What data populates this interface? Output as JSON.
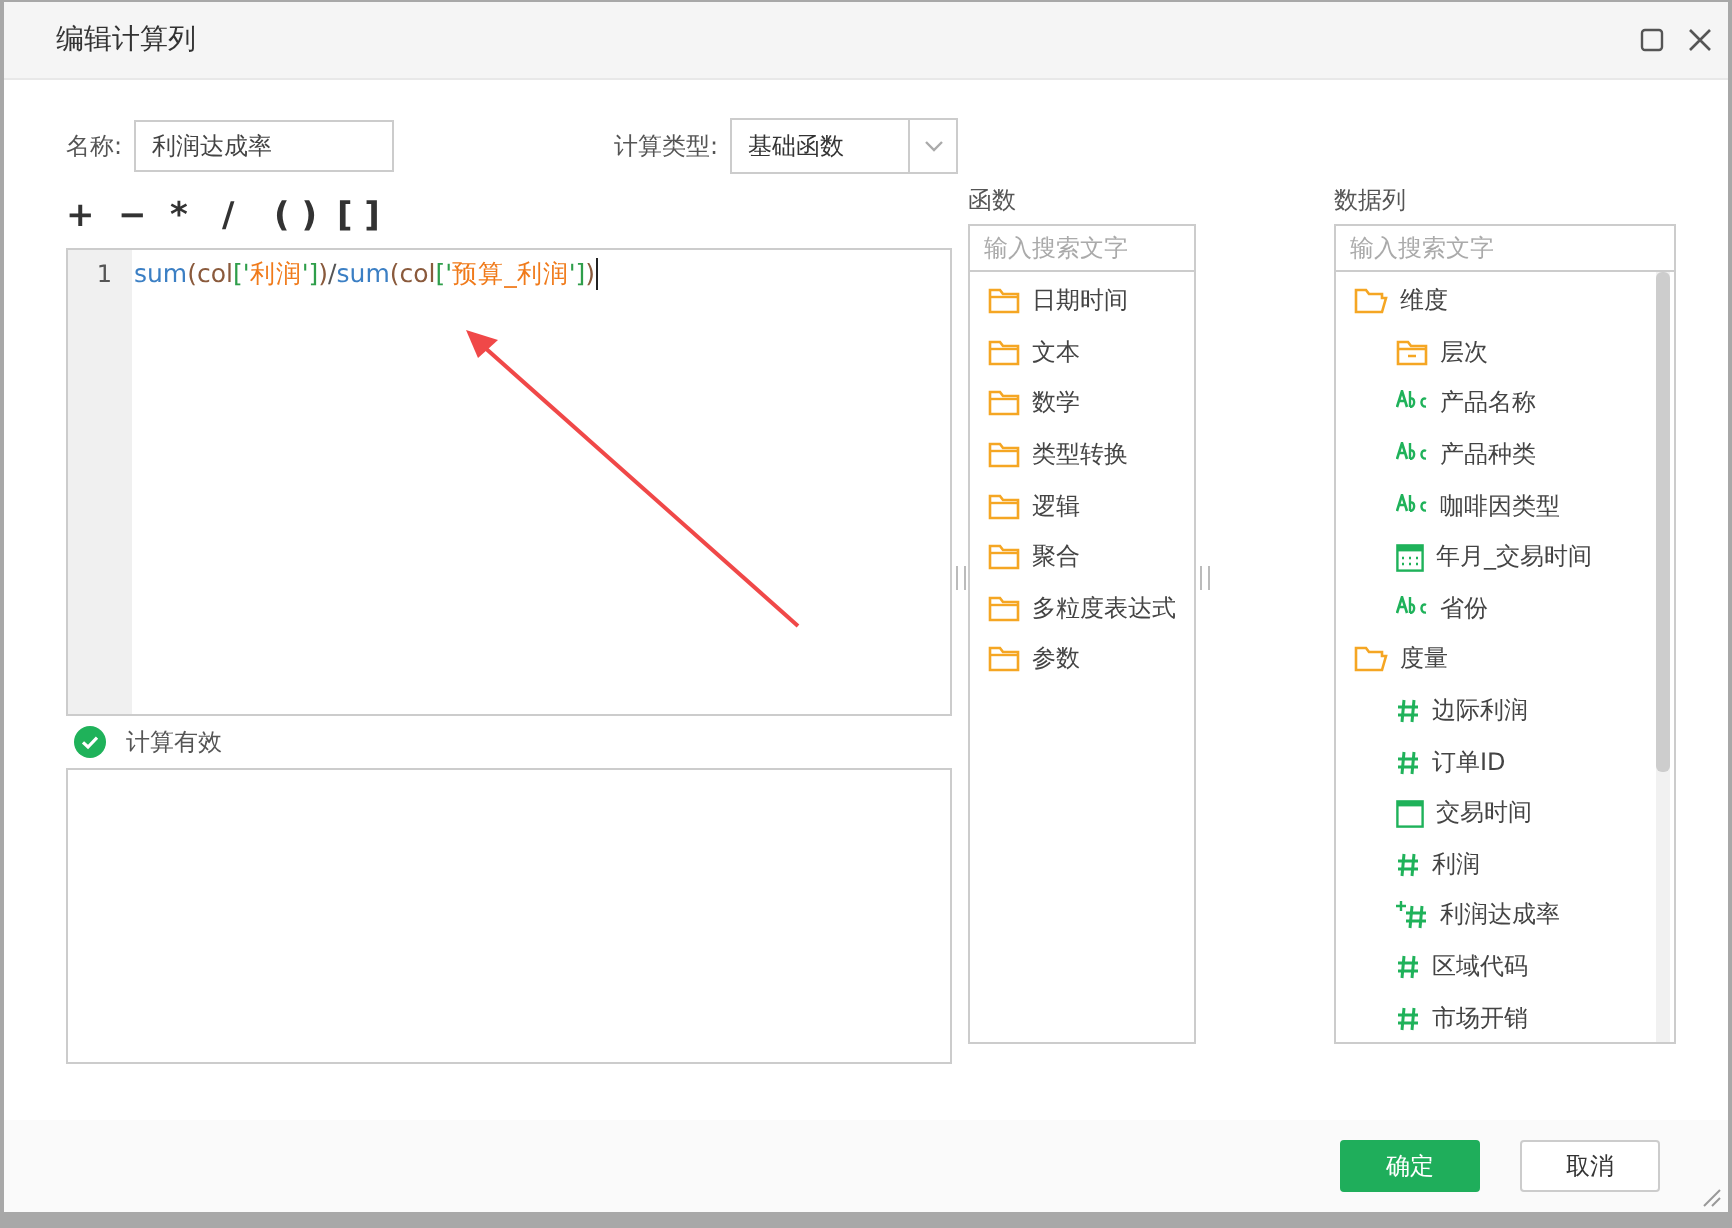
{
  "window": {
    "title": "编辑计算列"
  },
  "name_field": {
    "label": "名称:",
    "value": "利润达成率"
  },
  "calc_type": {
    "label": "计算类型:",
    "value": "基础函数"
  },
  "operators": [
    "+",
    "−",
    "*",
    "/",
    "( )",
    "[ ]"
  ],
  "editor": {
    "lines": [
      {
        "number": "1",
        "tokens": [
          {
            "kind": "func",
            "text": "sum"
          },
          {
            "kind": "paren",
            "text": "(col"
          },
          {
            "kind": "bracket",
            "text": "['"
          },
          {
            "kind": "string",
            "text": "利润"
          },
          {
            "kind": "bracket",
            "text": "']"
          },
          {
            "kind": "paren",
            "text": ")"
          },
          {
            "kind": "op",
            "text": "/"
          },
          {
            "kind": "func",
            "text": "sum"
          },
          {
            "kind": "paren",
            "text": "(col"
          },
          {
            "kind": "bracket",
            "text": "['"
          },
          {
            "kind": "string",
            "text": "预算_利润"
          },
          {
            "kind": "bracket",
            "text": "']"
          },
          {
            "kind": "paren",
            "text": ")"
          }
        ]
      }
    ]
  },
  "validation": {
    "valid": true,
    "message": "计算有效"
  },
  "functions": {
    "title": "函数",
    "search": {
      "placeholder": "输入搜索文字"
    },
    "items": [
      "日期时间",
      "文本",
      "数学",
      "类型转换",
      "逻辑",
      "聚合",
      "多粒度表达式",
      "参数"
    ]
  },
  "columns": {
    "title": "数据列",
    "search": {
      "placeholder": "输入搜索文字"
    },
    "tree": [
      {
        "label": "维度",
        "kind": "folder",
        "children": [
          {
            "label": "层次",
            "kind": "hierarchy"
          },
          {
            "label": "产品名称",
            "kind": "text"
          },
          {
            "label": "产品种类",
            "kind": "text"
          },
          {
            "label": "咖啡因类型",
            "kind": "text"
          },
          {
            "label": "年月_交易时间",
            "kind": "date"
          },
          {
            "label": "省份",
            "kind": "text"
          }
        ]
      },
      {
        "label": "度量",
        "kind": "folder",
        "children": [
          {
            "label": "边际利润",
            "kind": "number"
          },
          {
            "label": "订单ID",
            "kind": "number"
          },
          {
            "label": "交易时间",
            "kind": "datetime"
          },
          {
            "label": "利润",
            "kind": "number"
          },
          {
            "label": "利润达成率",
            "kind": "calc"
          },
          {
            "label": "区域代码",
            "kind": "number"
          },
          {
            "label": "市场开销",
            "kind": "number"
          }
        ]
      }
    ]
  },
  "buttons": [
    {
      "label": "确定",
      "kind": "primary"
    },
    {
      "label": "取消",
      "kind": "secondary"
    }
  ]
}
